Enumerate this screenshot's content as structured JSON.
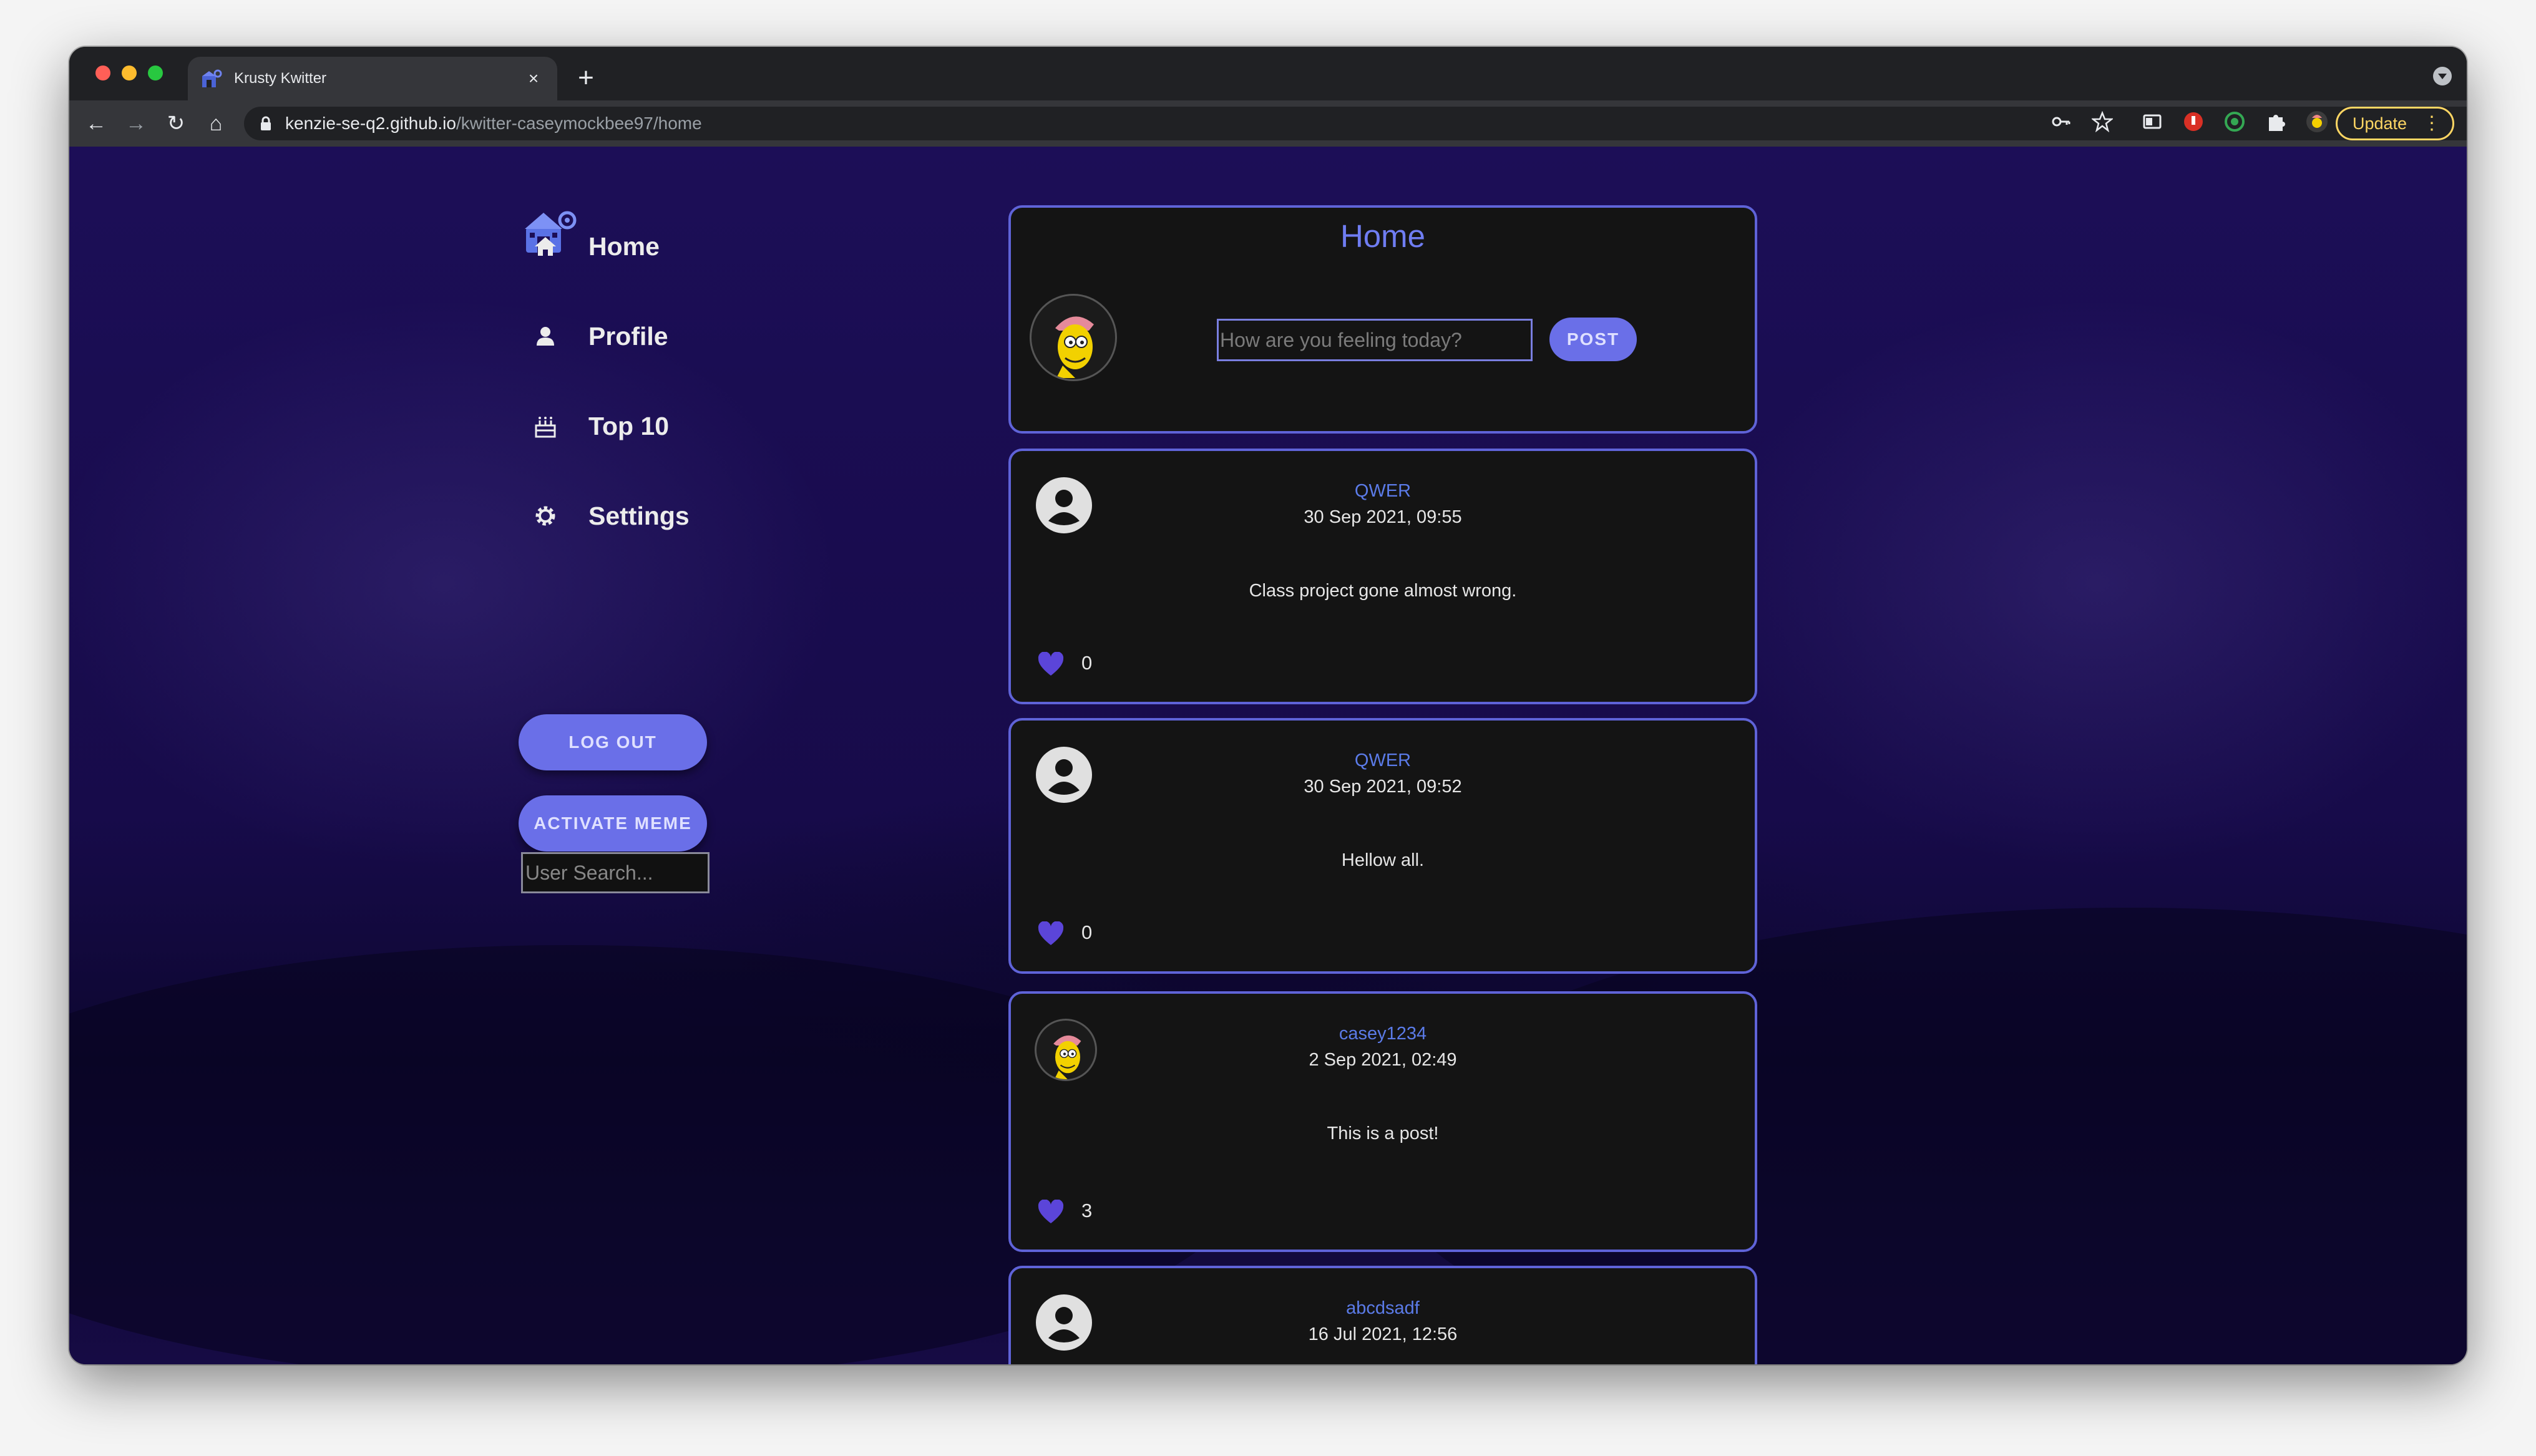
{
  "browser": {
    "tab_title": "Krusty Kwitter",
    "close_glyph": "×",
    "new_tab_glyph": "+",
    "url_host": "kenzie-se-q2.github.io",
    "url_path": "/kwitter-caseymockbee97/home",
    "update_label": "Update",
    "menu_glyph": "⋮",
    "nav": {
      "back": "←",
      "forward": "→",
      "reload": "↻",
      "home": "⌂"
    },
    "traffic_lights": [
      "#ff5f57",
      "#febc2e",
      "#28c840"
    ],
    "extension_icons": [
      "key-icon",
      "star-icon",
      "reading-list-icon",
      "extension-red-icon",
      "extension-green-icon",
      "puzzle-icon",
      "profile-avatar-icon"
    ]
  },
  "sidebar": {
    "logo_icon": "krusty-krab-logo-icon",
    "items": [
      {
        "label": "Home",
        "icon": "home-icon"
      },
      {
        "label": "Profile",
        "icon": "person-icon"
      },
      {
        "label": "Top 10",
        "icon": "cake-icon"
      },
      {
        "label": "Settings",
        "icon": "gear-icon"
      }
    ],
    "logout_label": "LOG OUT",
    "meme_label": "ACTIVATE MEME",
    "search_placeholder": "User Search..."
  },
  "home": {
    "title": "Home",
    "post_placeholder": "How are you feeling today?",
    "post_label": "POST"
  },
  "posts": [
    {
      "username": "QWER",
      "date": "30 Sep 2021, 09:55",
      "text": "Class project gone almost wrong.",
      "likes": "0",
      "avatar": "default-avatar-icon"
    },
    {
      "username": "QWER",
      "date": "30 Sep 2021, 09:52",
      "text": "Hellow all.",
      "likes": "0",
      "avatar": "default-avatar-icon"
    },
    {
      "username": "casey1234",
      "date": "2 Sep 2021, 02:49",
      "text": "This is a post!",
      "likes": "3",
      "avatar": "custom-avatar-icon"
    },
    {
      "username": "abcdsadf",
      "date": "16 Jul 2021, 12:56",
      "text": "",
      "likes": "",
      "avatar": "default-avatar-icon"
    }
  ],
  "colors": {
    "accent": "#6a6fe8",
    "card_border": "#5f63d8",
    "card_bg": "#141414",
    "username": "#5b7be8",
    "heart": "#5b45d9",
    "page_bg": "#1c0e57",
    "update": "#fdd663"
  }
}
